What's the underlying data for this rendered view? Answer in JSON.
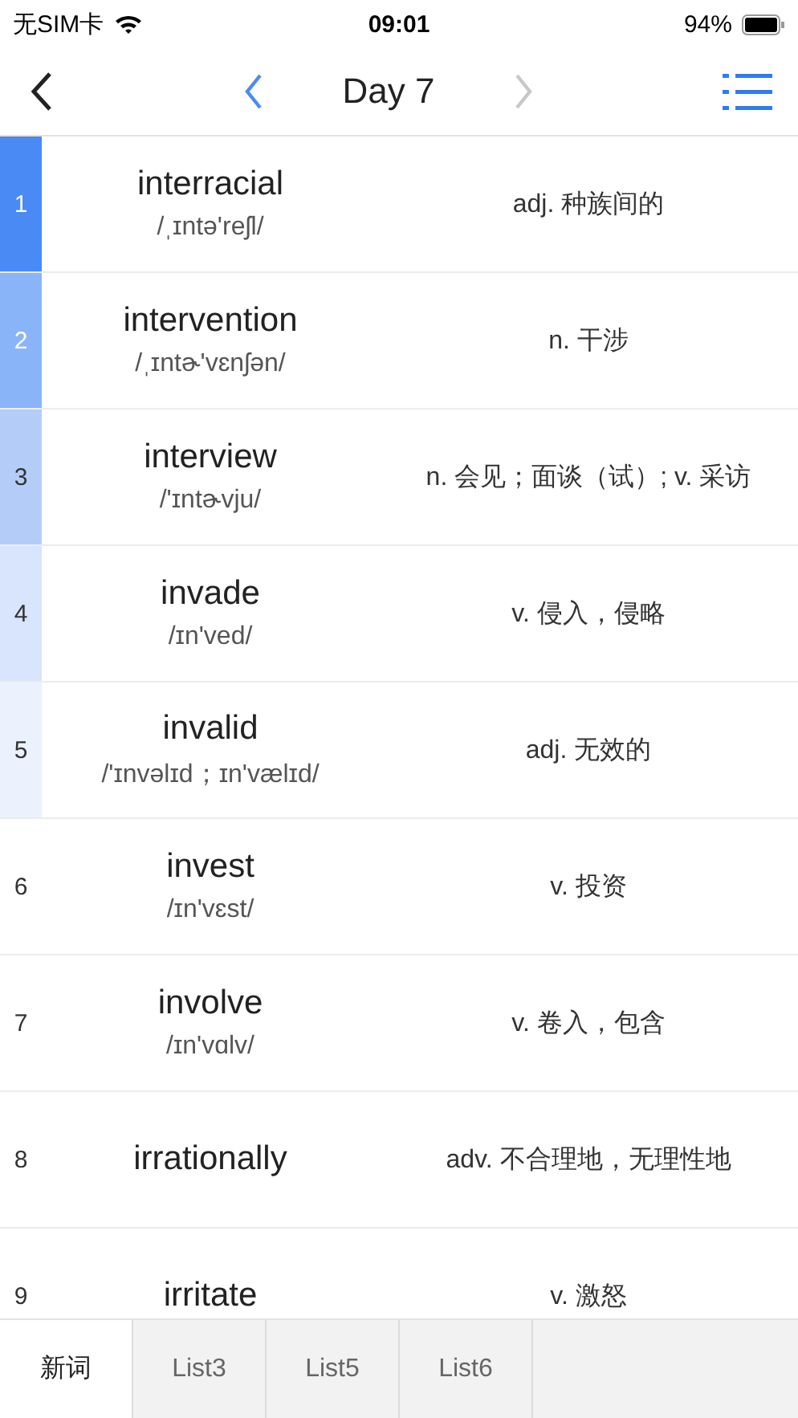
{
  "status_bar": {
    "carrier": "无SIM卡",
    "time": "09:01",
    "battery": "94%"
  },
  "nav": {
    "title": "Day 7"
  },
  "words": [
    {
      "index": "1",
      "word": "interracial",
      "phonetic": "/ˌɪntə'reʃl/",
      "meaning": "adj. 种族间的",
      "color": "#4a8af4"
    },
    {
      "index": "2",
      "word": "intervention",
      "phonetic": "/ˌɪntɚ'vɛnʃən/",
      "meaning": "n. 干涉",
      "color": "#8ab4f8"
    },
    {
      "index": "3",
      "word": "interview",
      "phonetic": "/'ɪntɚvju/",
      "meaning": "n. 会见；面谈（试）; v. 采访",
      "color": "#b4cdf8"
    },
    {
      "index": "4",
      "word": "invade",
      "phonetic": "/ɪn'ved/",
      "meaning": "v. 侵入，侵略",
      "color": "#d8e5fc"
    },
    {
      "index": "5",
      "word": "invalid",
      "phonetic": "/'ɪnvəlɪd；ɪn'vælɪd/",
      "meaning": "adj. 无效的",
      "color": "#ebf2fd"
    },
    {
      "index": "6",
      "word": "invest",
      "phonetic": "/ɪn'vɛst/",
      "meaning": "v. 投资"
    },
    {
      "index": "7",
      "word": "involve",
      "phonetic": "/ɪn'vɑlv/",
      "meaning": "v. 卷入，包含"
    },
    {
      "index": "8",
      "word": "irrationally",
      "meaning": "adv. 不合理地，无理性地"
    },
    {
      "index": "9",
      "word": "irritate",
      "meaning": "v. 激怒"
    }
  ],
  "tabs": [
    {
      "label": "新词",
      "selected": true
    },
    {
      "label": "List3",
      "selected": false
    },
    {
      "label": "List5",
      "selected": false
    },
    {
      "label": "List6",
      "selected": false
    }
  ]
}
